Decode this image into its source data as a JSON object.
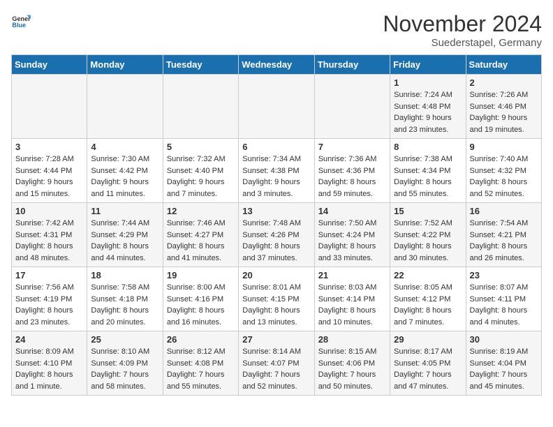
{
  "logo": {
    "general": "General",
    "blue": "Blue"
  },
  "title": "November 2024",
  "subtitle": "Suederstapel, Germany",
  "headers": [
    "Sunday",
    "Monday",
    "Tuesday",
    "Wednesday",
    "Thursday",
    "Friday",
    "Saturday"
  ],
  "weeks": [
    {
      "days": [
        {
          "num": "",
          "info": ""
        },
        {
          "num": "",
          "info": ""
        },
        {
          "num": "",
          "info": ""
        },
        {
          "num": "",
          "info": ""
        },
        {
          "num": "",
          "info": ""
        },
        {
          "num": "1",
          "info": "Sunrise: 7:24 AM\nSunset: 4:48 PM\nDaylight: 9 hours\nand 23 minutes."
        },
        {
          "num": "2",
          "info": "Sunrise: 7:26 AM\nSunset: 4:46 PM\nDaylight: 9 hours\nand 19 minutes."
        }
      ]
    },
    {
      "days": [
        {
          "num": "3",
          "info": "Sunrise: 7:28 AM\nSunset: 4:44 PM\nDaylight: 9 hours\nand 15 minutes."
        },
        {
          "num": "4",
          "info": "Sunrise: 7:30 AM\nSunset: 4:42 PM\nDaylight: 9 hours\nand 11 minutes."
        },
        {
          "num": "5",
          "info": "Sunrise: 7:32 AM\nSunset: 4:40 PM\nDaylight: 9 hours\nand 7 minutes."
        },
        {
          "num": "6",
          "info": "Sunrise: 7:34 AM\nSunset: 4:38 PM\nDaylight: 9 hours\nand 3 minutes."
        },
        {
          "num": "7",
          "info": "Sunrise: 7:36 AM\nSunset: 4:36 PM\nDaylight: 8 hours\nand 59 minutes."
        },
        {
          "num": "8",
          "info": "Sunrise: 7:38 AM\nSunset: 4:34 PM\nDaylight: 8 hours\nand 55 minutes."
        },
        {
          "num": "9",
          "info": "Sunrise: 7:40 AM\nSunset: 4:32 PM\nDaylight: 8 hours\nand 52 minutes."
        }
      ]
    },
    {
      "days": [
        {
          "num": "10",
          "info": "Sunrise: 7:42 AM\nSunset: 4:31 PM\nDaylight: 8 hours\nand 48 minutes."
        },
        {
          "num": "11",
          "info": "Sunrise: 7:44 AM\nSunset: 4:29 PM\nDaylight: 8 hours\nand 44 minutes."
        },
        {
          "num": "12",
          "info": "Sunrise: 7:46 AM\nSunset: 4:27 PM\nDaylight: 8 hours\nand 41 minutes."
        },
        {
          "num": "13",
          "info": "Sunrise: 7:48 AM\nSunset: 4:26 PM\nDaylight: 8 hours\nand 37 minutes."
        },
        {
          "num": "14",
          "info": "Sunrise: 7:50 AM\nSunset: 4:24 PM\nDaylight: 8 hours\nand 33 minutes."
        },
        {
          "num": "15",
          "info": "Sunrise: 7:52 AM\nSunset: 4:22 PM\nDaylight: 8 hours\nand 30 minutes."
        },
        {
          "num": "16",
          "info": "Sunrise: 7:54 AM\nSunset: 4:21 PM\nDaylight: 8 hours\nand 26 minutes."
        }
      ]
    },
    {
      "days": [
        {
          "num": "17",
          "info": "Sunrise: 7:56 AM\nSunset: 4:19 PM\nDaylight: 8 hours\nand 23 minutes."
        },
        {
          "num": "18",
          "info": "Sunrise: 7:58 AM\nSunset: 4:18 PM\nDaylight: 8 hours\nand 20 minutes."
        },
        {
          "num": "19",
          "info": "Sunrise: 8:00 AM\nSunset: 4:16 PM\nDaylight: 8 hours\nand 16 minutes."
        },
        {
          "num": "20",
          "info": "Sunrise: 8:01 AM\nSunset: 4:15 PM\nDaylight: 8 hours\nand 13 minutes."
        },
        {
          "num": "21",
          "info": "Sunrise: 8:03 AM\nSunset: 4:14 PM\nDaylight: 8 hours\nand 10 minutes."
        },
        {
          "num": "22",
          "info": "Sunrise: 8:05 AM\nSunset: 4:12 PM\nDaylight: 8 hours\nand 7 minutes."
        },
        {
          "num": "23",
          "info": "Sunrise: 8:07 AM\nSunset: 4:11 PM\nDaylight: 8 hours\nand 4 minutes."
        }
      ]
    },
    {
      "days": [
        {
          "num": "24",
          "info": "Sunrise: 8:09 AM\nSunset: 4:10 PM\nDaylight: 8 hours\nand 1 minute."
        },
        {
          "num": "25",
          "info": "Sunrise: 8:10 AM\nSunset: 4:09 PM\nDaylight: 7 hours\nand 58 minutes."
        },
        {
          "num": "26",
          "info": "Sunrise: 8:12 AM\nSunset: 4:08 PM\nDaylight: 7 hours\nand 55 minutes."
        },
        {
          "num": "27",
          "info": "Sunrise: 8:14 AM\nSunset: 4:07 PM\nDaylight: 7 hours\nand 52 minutes."
        },
        {
          "num": "28",
          "info": "Sunrise: 8:15 AM\nSunset: 4:06 PM\nDaylight: 7 hours\nand 50 minutes."
        },
        {
          "num": "29",
          "info": "Sunrise: 8:17 AM\nSunset: 4:05 PM\nDaylight: 7 hours\nand 47 minutes."
        },
        {
          "num": "30",
          "info": "Sunrise: 8:19 AM\nSunset: 4:04 PM\nDaylight: 7 hours\nand 45 minutes."
        }
      ]
    }
  ]
}
